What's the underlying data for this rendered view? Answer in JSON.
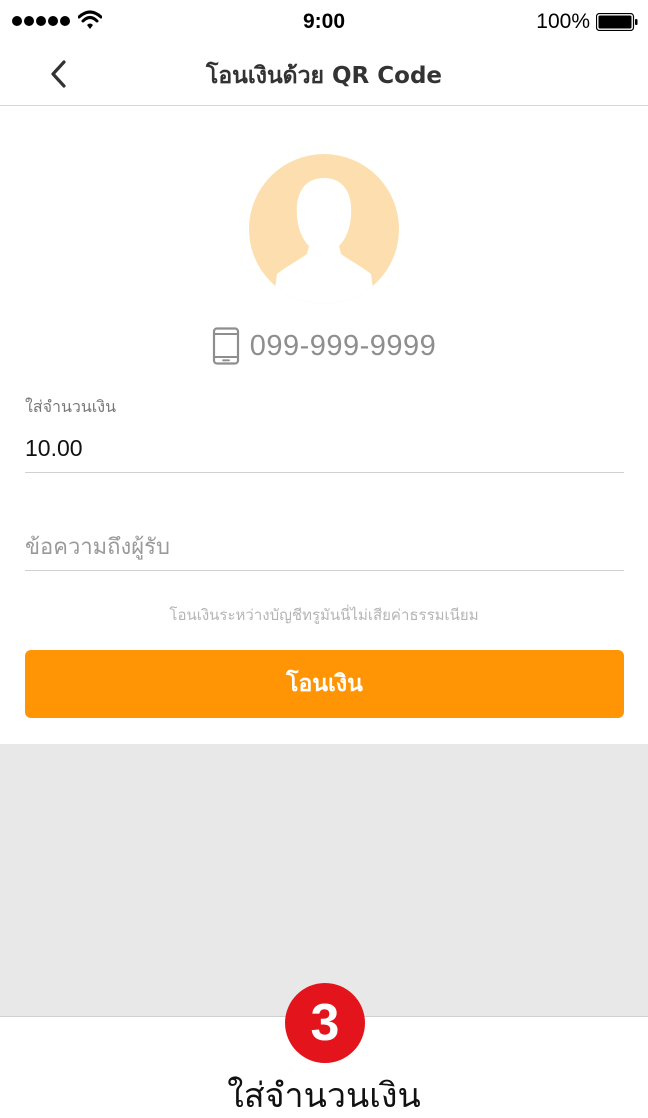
{
  "status_bar": {
    "time": "9:00",
    "battery_percent": "100%",
    "signal_dots": 5,
    "icons": [
      "signal-dots-icon",
      "wifi-icon",
      "battery-icon"
    ]
  },
  "nav": {
    "back_icon": "chevron-left-icon",
    "title": "โอนเงินด้วย QR Code"
  },
  "recipient": {
    "avatar_icon": "person-silhouette-icon",
    "phone_icon": "mobile-phone-icon",
    "phone_number": "099-999-9999"
  },
  "form": {
    "amount_label": "ใส่จำนวนเงิน",
    "amount_value": "10.00",
    "message_placeholder": "ข้อความถึงผู้รับ",
    "fee_note": "โอนเงินระหว่างบัญชีทรูมันนี่ไม่เสียค่าธรรมเนียม",
    "transfer_button_label": "โอนเงิน"
  },
  "step": {
    "number": "3",
    "caption": "ใส่จำนวนเงิน"
  },
  "colors": {
    "accent": "#ff9505",
    "avatar_bg": "#fddfaf",
    "badge": "#e3141b",
    "lower_background": "#e8e8e8"
  }
}
